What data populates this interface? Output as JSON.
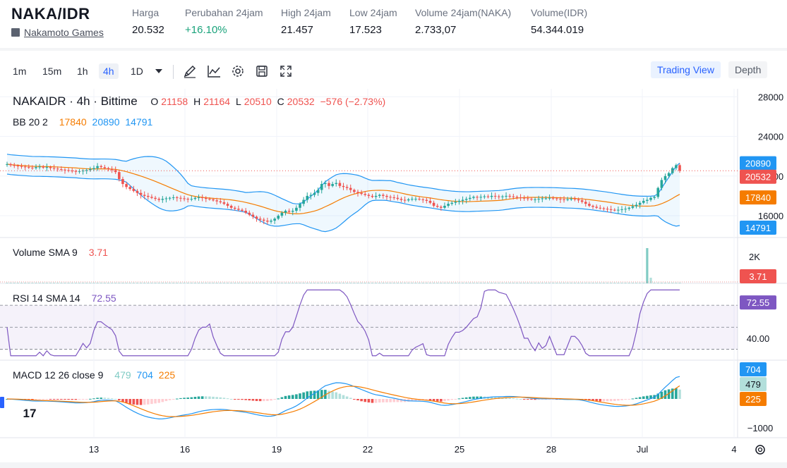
{
  "header": {
    "pair": "NAKA/IDR",
    "project": "Nakamoto Games",
    "stats": [
      {
        "label": "Harga",
        "value": "20.532"
      },
      {
        "label": "Perubahan 24jam",
        "value": "+16.10%"
      },
      {
        "label": "High 24jam",
        "value": "21.457"
      },
      {
        "label": "Low 24jam",
        "value": "17.523"
      },
      {
        "label": "Volume 24jam(NAKA)",
        "value": "2.733,07"
      },
      {
        "label": "Volume(IDR)",
        "value": "54.344.019"
      }
    ]
  },
  "toolbar": {
    "timeframes": [
      "1m",
      "15m",
      "1h",
      "4h",
      "1D"
    ],
    "active_timeframe": "4h",
    "tools": [
      "draw-icon",
      "indicator-icon",
      "settings-icon",
      "save-icon",
      "fullscreen-icon"
    ],
    "views": [
      "Trading View",
      "Depth"
    ],
    "active_view": "Trading View"
  },
  "legend": {
    "symbol": "NAKAIDR · 4h · Bittime",
    "ohlc": {
      "o": "21158",
      "h": "21164",
      "l": "20510",
      "c": "20532",
      "change": "−576 (−2.73%)"
    },
    "bb": {
      "name": "BB 20 2",
      "basis": "17840",
      "upper": "20890",
      "lower": "14791"
    },
    "volume": {
      "name": "Volume SMA 9",
      "value": "3.71"
    },
    "rsi": {
      "name": "RSI 14 SMA 14",
      "value": "72.55"
    },
    "macd": {
      "name": "MACD 12 26 close 9",
      "hist": "479",
      "macd": "704",
      "signal": "225"
    }
  },
  "colors": {
    "up": "#26a69a",
    "down": "#ef5350",
    "bb_basis": "#f57c00",
    "bb_band": "#2196f3",
    "rsi": "#7e57c2",
    "macd": "#2196f3",
    "signal": "#f57c00",
    "accent": "#2962ff"
  },
  "chart_data": [
    {
      "type": "candlestick",
      "title": "NAKAIDR · 4h · Bittime",
      "x_ticks": [
        "13",
        "16",
        "19",
        "22",
        "25",
        "28",
        "Jul",
        "4"
      ],
      "y_ticks": [
        "28000",
        "24000",
        "20000",
        "16000"
      ],
      "ylim": [
        13800,
        28800
      ],
      "price_labels": {
        "upper": "20890",
        "last": "20532",
        "basis": "17840",
        "lower": "14791"
      },
      "last_price": 20532
    },
    {
      "type": "bar",
      "title": "Volume SMA 9",
      "y_ticks": [
        "2K"
      ],
      "last_value": "3.71"
    },
    {
      "type": "line",
      "title": "RSI 14 SMA 14",
      "y_ticks": [
        "40.00"
      ],
      "levels": [
        30,
        50,
        70
      ],
      "ylim": [
        20,
        90
      ],
      "last_value": "72.55"
    },
    {
      "type": "bar",
      "title": "MACD 12 26 close 9",
      "y_ticks": [
        "−1000"
      ],
      "last_values": {
        "hist": "479",
        "macd": "704",
        "signal": "225"
      }
    }
  ]
}
